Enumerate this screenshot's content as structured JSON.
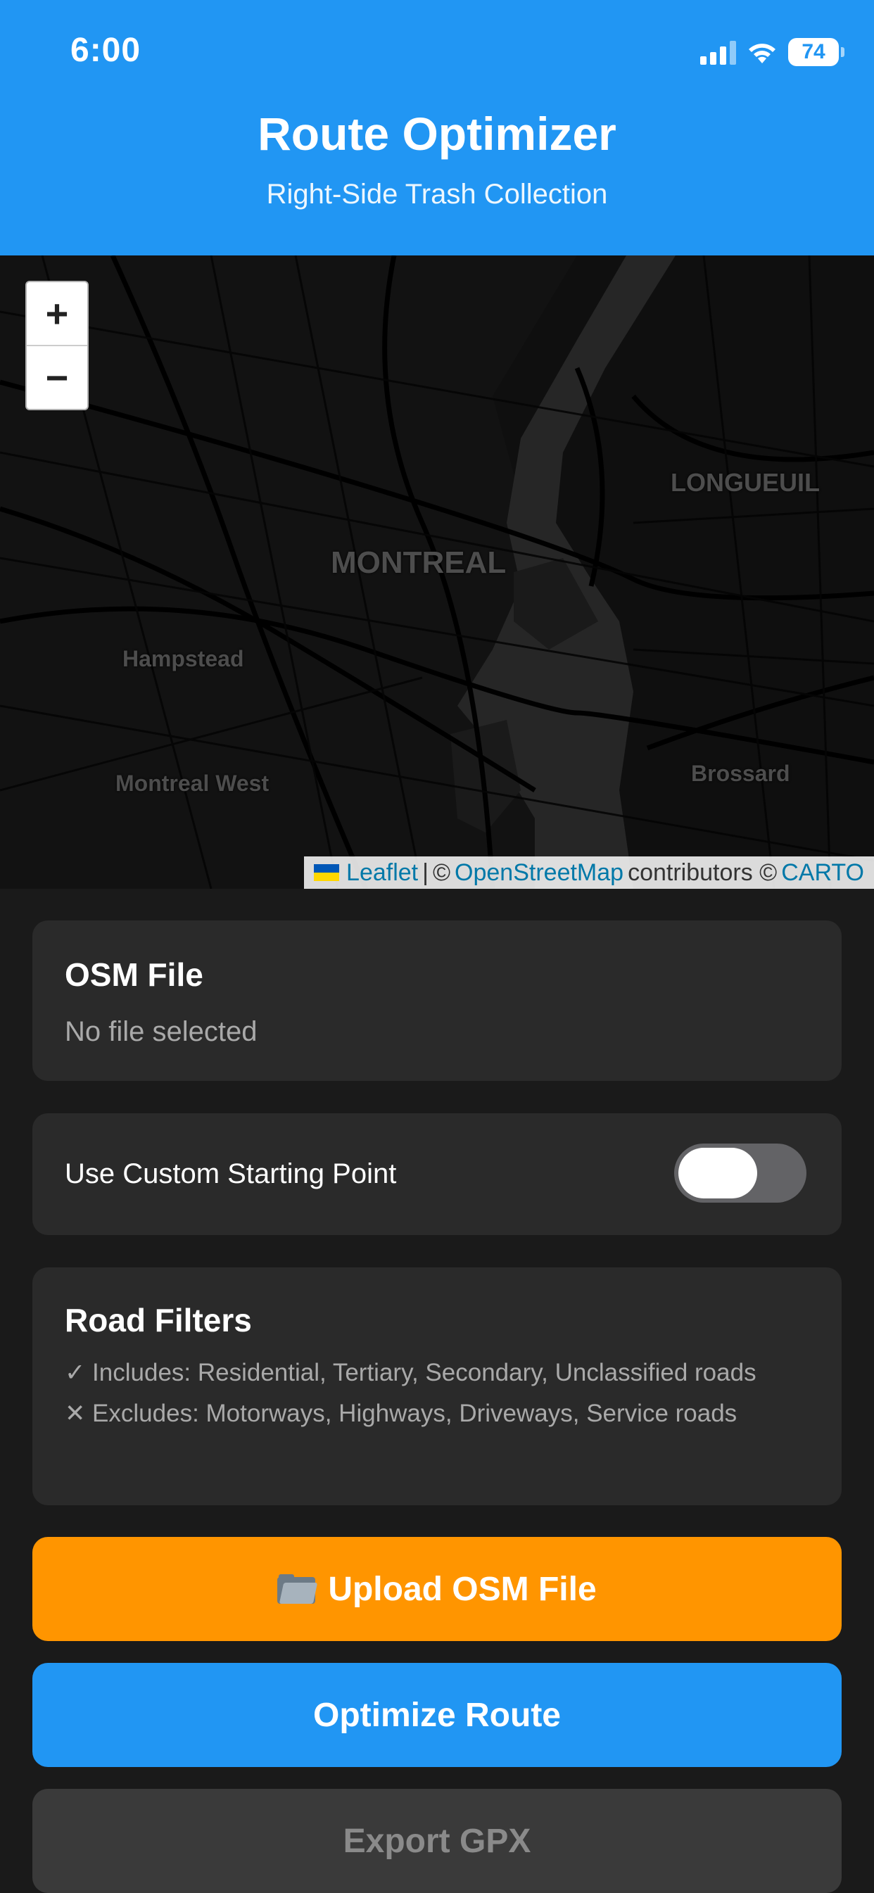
{
  "status_bar": {
    "time": "6:00",
    "battery": "74"
  },
  "header": {
    "title": "Route Optimizer",
    "subtitle": "Right-Side Trash Collection"
  },
  "map": {
    "zoom_in": "+",
    "zoom_out": "−",
    "labels": {
      "montreal": "MONTREAL",
      "longueuil": "LONGUEUIL",
      "hampstead": "Hampstead",
      "montreal_west": "Montreal West",
      "brossard": "Brossard"
    },
    "attribution": {
      "leaflet": "Leaflet",
      "separator": "|",
      "copy1": "©",
      "osm": "OpenStreetMap",
      "contributors": "contributors ©",
      "carto": "CARTO"
    }
  },
  "osm_file": {
    "title": "OSM File",
    "status": "No file selected"
  },
  "custom_start": {
    "label": "Use Custom Starting Point",
    "enabled": false
  },
  "road_filters": {
    "title": "Road Filters",
    "includes": "✓ Includes: Residential, Tertiary, Secondary, Unclassified roads",
    "excludes": "✕ Excludes: Motorways, Highways, Driveways, Service roads"
  },
  "buttons": {
    "upload": "Upload OSM File",
    "optimize": "Optimize Route",
    "export": "Export GPX"
  },
  "colors": {
    "primary": "#2196f3",
    "upload": "#ff9500",
    "export_bg": "#3a3a3a",
    "export_text": "#8a8a8a"
  },
  "icons": {
    "upload": "folder-icon"
  }
}
